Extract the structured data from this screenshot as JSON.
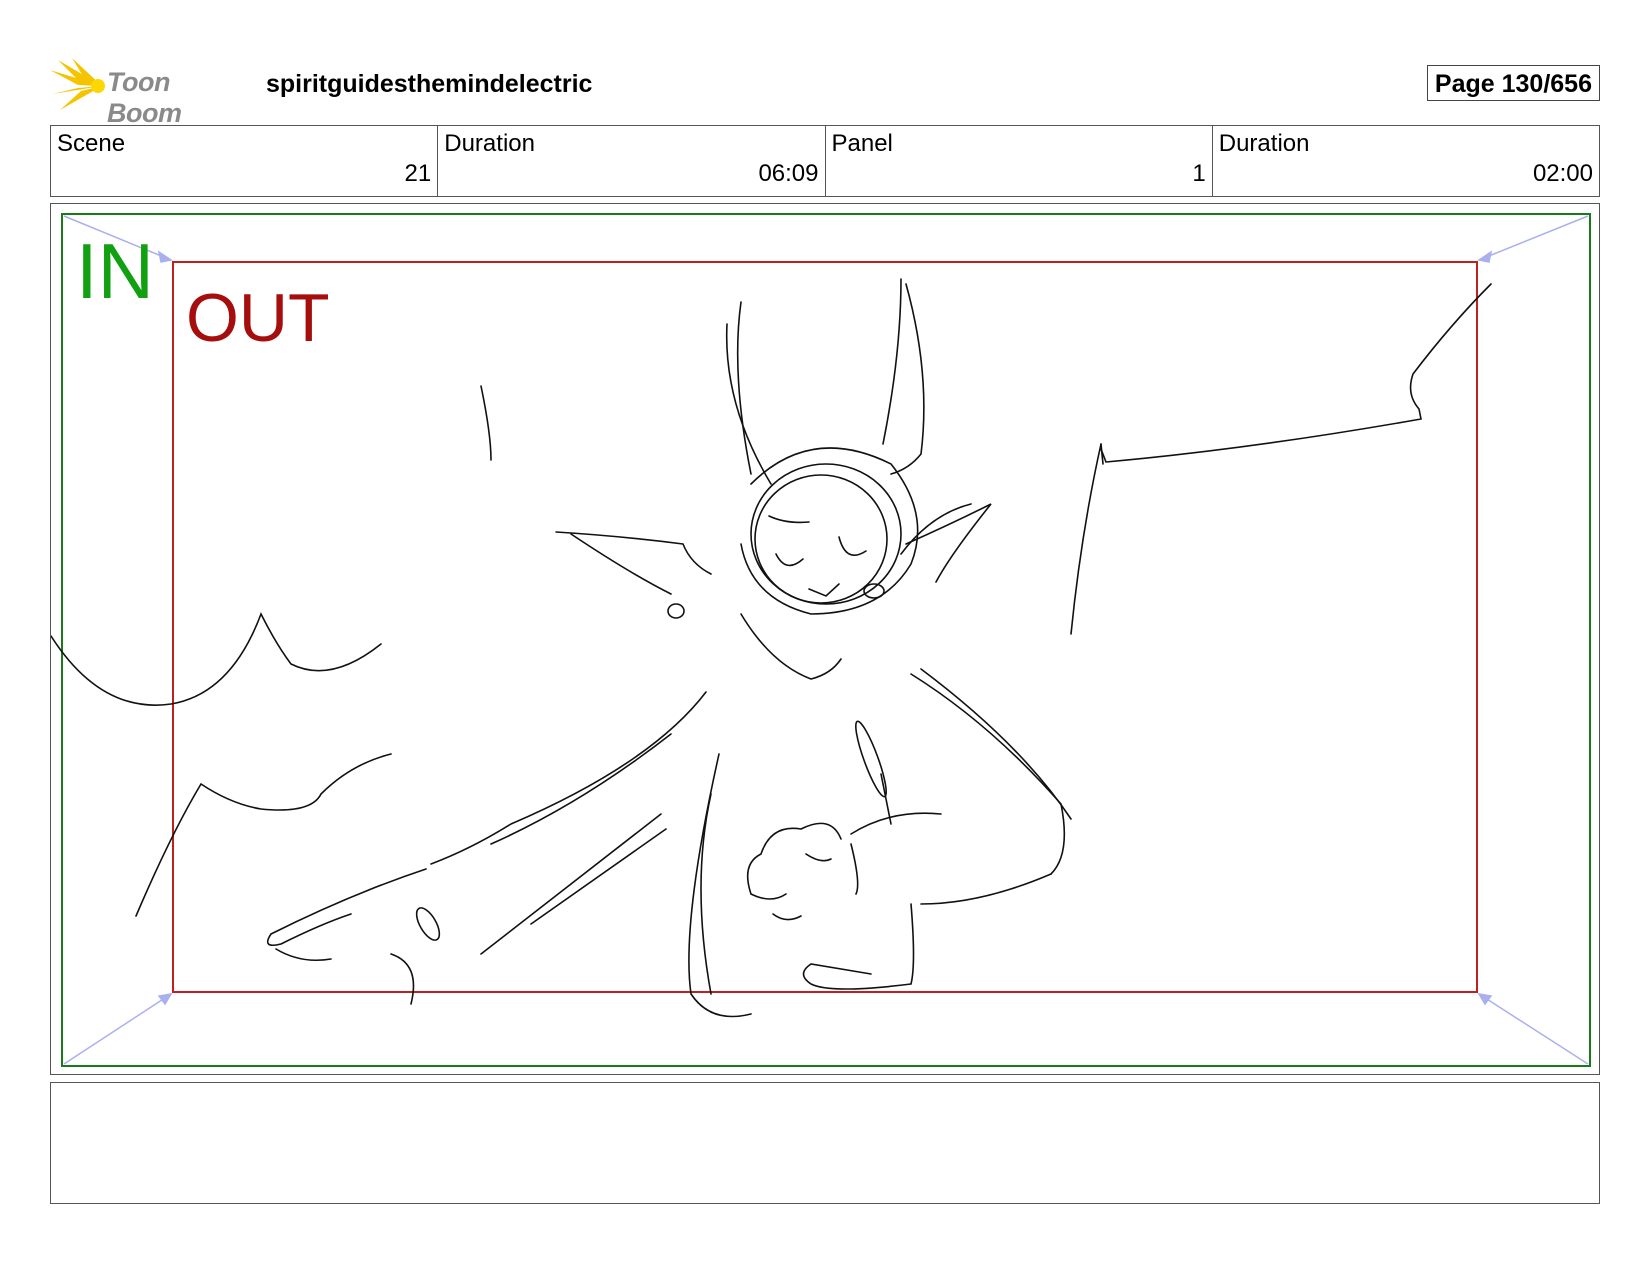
{
  "header": {
    "logo_text": "Toon Boom",
    "project_title": "spiritguidesthemindelectric",
    "page_label": "Page 130/656"
  },
  "info": {
    "scene_label": "Scene",
    "scene_value": "21",
    "scene_duration_label": "Duration",
    "scene_duration_value": "06:09",
    "panel_label": "Panel",
    "panel_value": "1",
    "panel_duration_label": "Duration",
    "panel_duration_value": "02:00"
  },
  "panel": {
    "in_label": "IN",
    "out_label": "OUT",
    "in_frame_color": "#1a7a1a",
    "out_frame_color": "#c02020",
    "arrow_color": "#aab0ee"
  },
  "notes": {
    "text": ""
  }
}
